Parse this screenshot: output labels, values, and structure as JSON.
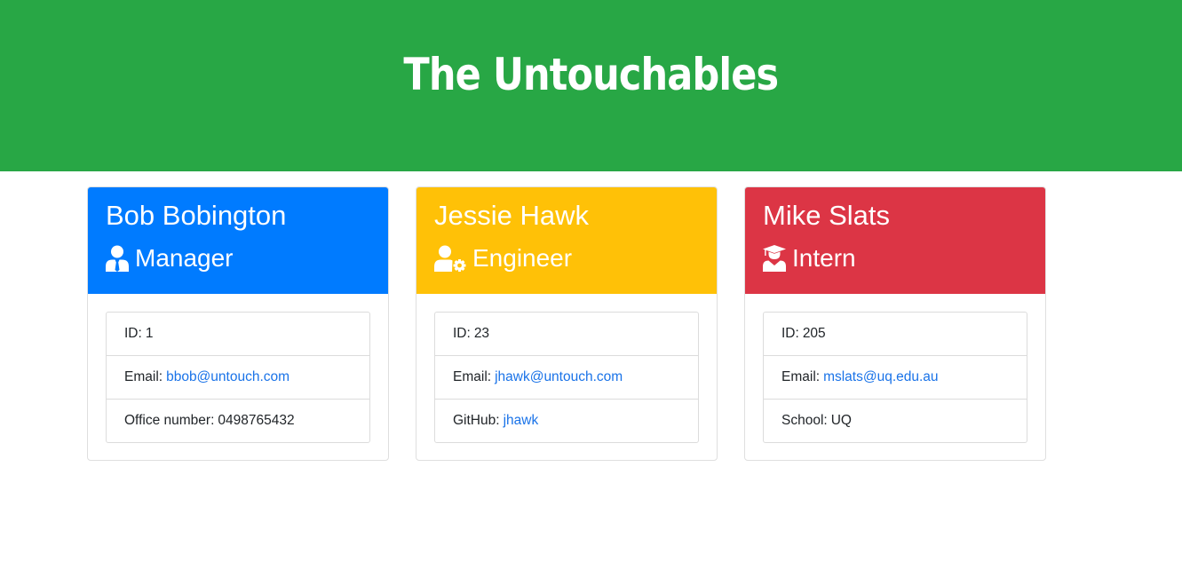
{
  "header": {
    "title": "The Untouchables"
  },
  "colors": {
    "banner": "#28a745",
    "manager": "#007bff",
    "engineer": "#ffc107",
    "intern": "#dc3545",
    "link": "#1a73e8"
  },
  "employees": [
    {
      "name": "Bob Bobington",
      "role": "Manager",
      "role_icon": "user-tie-icon",
      "id_label": "ID:",
      "id_value": "1",
      "email_label": "Email:",
      "email_value": "bbob@untouch.com",
      "extra_label": "Office number:",
      "extra_value": "0498765432"
    },
    {
      "name": "Jessie Hawk",
      "role": "Engineer",
      "role_icon": "user-cog-icon",
      "id_label": "ID:",
      "id_value": "23",
      "email_label": "Email:",
      "email_value": "jhawk@untouch.com",
      "extra_label": "GitHub:",
      "extra_value": "jhawk"
    },
    {
      "name": "Mike Slats",
      "role": "Intern",
      "role_icon": "user-graduate-icon",
      "id_label": "ID:",
      "id_value": "205",
      "email_label": "Email:",
      "email_value": "mslats@uq.edu.au",
      "extra_label": "School:",
      "extra_value": "UQ"
    }
  ]
}
